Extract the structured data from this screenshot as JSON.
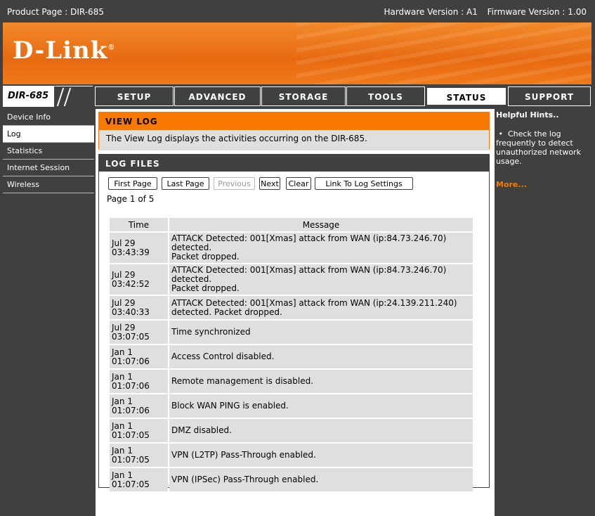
{
  "topbar": {
    "product": "Product Page :  DIR-685",
    "hardware": "Hardware Version : A1",
    "firmware": "Firmware Version : 1.00"
  },
  "brand": {
    "logo": "D-Link",
    "model": "DIR-685",
    "accent": "#f87a00"
  },
  "tabs": [
    "SETUP",
    "ADVANCED",
    "STORAGE",
    "TOOLS",
    "STATUS",
    "SUPPORT"
  ],
  "active_tab": "STATUS",
  "sidebar": {
    "items": [
      "Device Info",
      "Log",
      "Statistics",
      "Internet Session",
      "Wireless"
    ],
    "active": "Log"
  },
  "view_log": {
    "title": "VIEW LOG",
    "desc": "The View Log displays the activities occurring on the DIR-685."
  },
  "log_files": {
    "title": "LOG FILES",
    "buttons": {
      "first": "First Page",
      "last": "Last Page",
      "previous": "Previous",
      "next": "Next",
      "clear": "Clear",
      "link": "Link To Log Settings"
    },
    "page_info": "Page 1 of 5",
    "columns": {
      "time": "Time",
      "message": "Message"
    },
    "rows": [
      {
        "date": "Jul 29",
        "time": "03:43:39",
        "msg1": "ATTACK Detected: 001[Xmas] attack from WAN (ip:84.73.246.70) detected.",
        "msg2": "Packet dropped."
      },
      {
        "date": "Jul 29",
        "time": "03:42:52",
        "msg1": "ATTACK Detected: 001[Xmas] attack from WAN (ip:84.73.246.70) detected.",
        "msg2": "Packet dropped."
      },
      {
        "date": "Jul 29",
        "time": "03:40:33",
        "msg1": "ATTACK Detected: 001[Xmas] attack from WAN (ip:24.139.211.240)",
        "msg2": "detected. Packet dropped."
      },
      {
        "date": "Jul 29",
        "time": "03:07:05",
        "msg1": "Time synchronized",
        "msg2": ""
      },
      {
        "date": "Jan 1",
        "time": "01:07:06",
        "msg1": "Access Control disabled.",
        "msg2": ""
      },
      {
        "date": "Jan 1",
        "time": "01:07:06",
        "msg1": "Remote management is disabled.",
        "msg2": ""
      },
      {
        "date": "Jan 1",
        "time": "01:07:06",
        "msg1": "Block WAN PING is enabled.",
        "msg2": ""
      },
      {
        "date": "Jan 1",
        "time": "01:07:05",
        "msg1": "DMZ disabled.",
        "msg2": ""
      },
      {
        "date": "Jan 1",
        "time": "01:07:05",
        "msg1": "VPN (L2TP) Pass-Through enabled.",
        "msg2": ""
      },
      {
        "date": "Jan 1",
        "time": "01:07:05",
        "msg1": "VPN (IPSec) Pass-Through enabled.",
        "msg2": ""
      }
    ]
  },
  "hints": {
    "title": "Helpful Hints..",
    "bullet": "•",
    "item": "Check the log frequently to detect unauthorized network usage.",
    "more": "More..."
  }
}
